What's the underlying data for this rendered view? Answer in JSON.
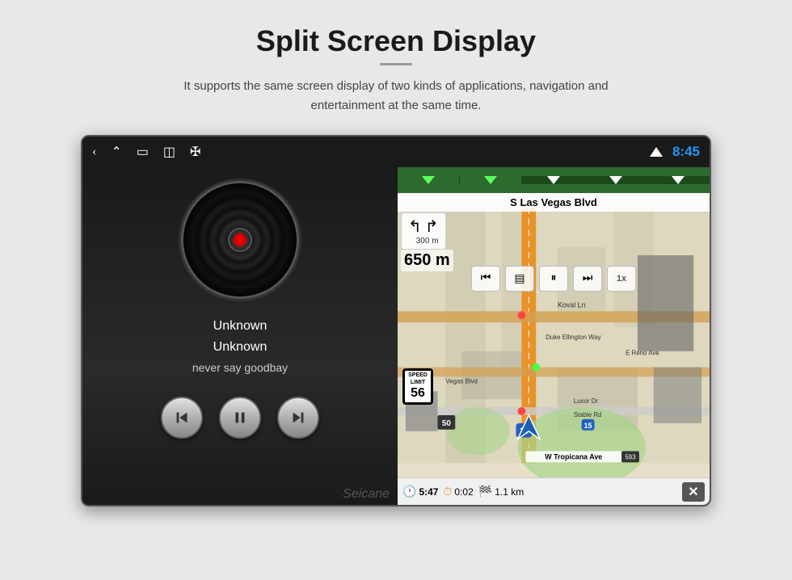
{
  "page": {
    "title": "Split Screen Display",
    "subtitle": "It supports the same screen display of two kinds of applications, navigation and entertainment at the same time."
  },
  "status_bar": {
    "time": "8:45",
    "icons": [
      "back",
      "home",
      "window",
      "image",
      "usb"
    ]
  },
  "music_panel": {
    "track_title": "Unknown",
    "track_artist": "Unknown",
    "track_song": "never say goodbay",
    "controls": {
      "prev": "⏮",
      "pause": "⏸",
      "next": "⏭"
    }
  },
  "nav_panel": {
    "street_name": "S Las Vegas Blvd",
    "turn_distance": "300 m",
    "distance_label": "650 m",
    "media_controls": [
      "⏮",
      "☰",
      "⏸",
      "⏭",
      "1x"
    ],
    "speed_limit": {
      "label": "SPEED LIMIT",
      "value": "56"
    },
    "bottom_bar": {
      "time_start": "5:47",
      "time_elapsed": "0:02",
      "distance": "1.1 km"
    }
  },
  "watermark": "Seicane"
}
